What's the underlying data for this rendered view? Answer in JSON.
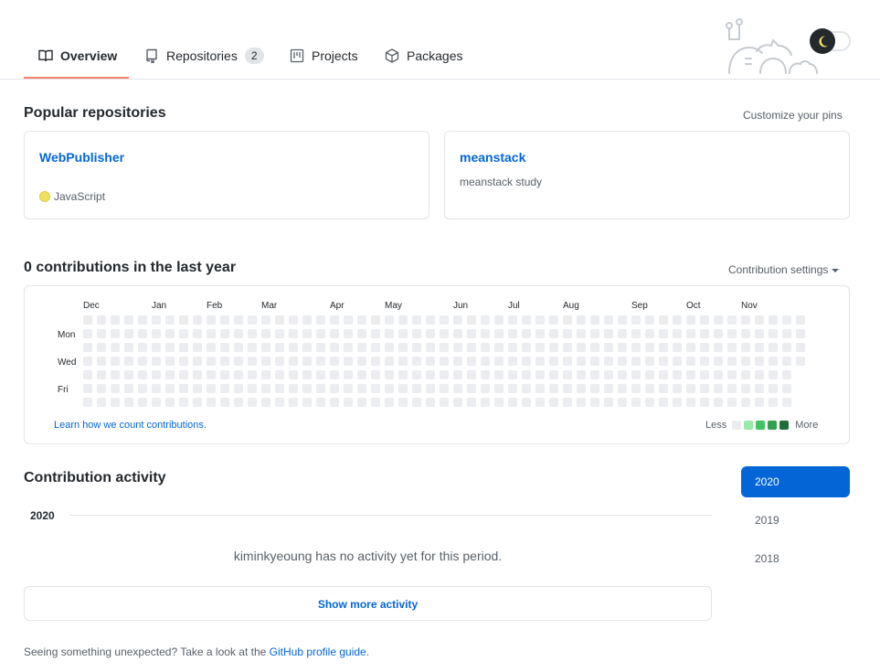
{
  "tabs": [
    {
      "label": "Overview",
      "icon": "book-icon",
      "selected": true
    },
    {
      "label": "Repositories",
      "icon": "repo-icon",
      "count": "2"
    },
    {
      "label": "Projects",
      "icon": "project-icon"
    },
    {
      "label": "Packages",
      "icon": "package-icon"
    }
  ],
  "popular": {
    "title": "Popular repositories",
    "customize": "Customize your pins",
    "repos": [
      {
        "name": "WebPublisher",
        "description": "",
        "language": "JavaScript",
        "language_color": "#f1e05a"
      },
      {
        "name": "meanstack",
        "description": "meanstack study",
        "language": ""
      }
    ]
  },
  "contributions": {
    "title": "0 contributions in the last year",
    "settings": "Contribution settings",
    "months": [
      "Dec",
      "Jan",
      "Feb",
      "Mar",
      "Apr",
      "May",
      "Jun",
      "Jul",
      "Aug",
      "Sep",
      "Oct",
      "Nov"
    ],
    "days": [
      "Mon",
      "Wed",
      "Fri"
    ],
    "learn_link": "Learn how we count contributions.",
    "legend_less": "Less",
    "legend_more": "More",
    "legend_colors": [
      "#ebedf0",
      "#9be9a8",
      "#40c463",
      "#30a14e",
      "#216e39"
    ],
    "empty_color": "#ebedf0"
  },
  "activity": {
    "title": "Contribution activity",
    "year": "2020",
    "message": "kiminkyeoung has no activity yet for this period.",
    "show_more": "Show more activity",
    "years": [
      "2020",
      "2019",
      "2018"
    ],
    "active_year": "2020"
  },
  "footer": {
    "prefix": "Seeing something unexpected? Take a look at the",
    "link": "GitHub profile guide",
    "suffix": "."
  },
  "colors": {
    "accent": "#0366d6",
    "tab_underline": "#f9826c"
  }
}
